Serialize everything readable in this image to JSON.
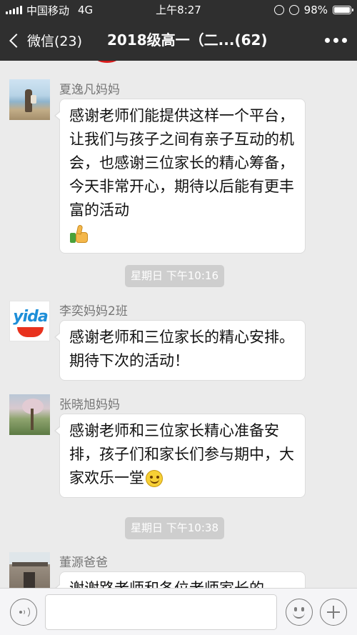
{
  "status_bar": {
    "carrier": "中国移动",
    "network": "4G",
    "time": "上午8:27",
    "battery_text": "98%",
    "battery_level": 0.98
  },
  "nav": {
    "back_label": "微信(23)",
    "title": "2018级高一（二...(62)"
  },
  "messages": [
    {
      "sender": "夏逸凡妈妈",
      "avatar": "beach-photo-avatar",
      "text": "感谢老师们能提供这样一个平台，让我们与孩子之间有亲子互动的机会，也感谢三位家长的精心筹备，今天非常开心，期待以后能有更丰富的活动",
      "emoji": "thumbs-up-emoji"
    },
    {
      "sender": "李奕妈妈2班",
      "avatar": "yida-logo-avatar",
      "avatar_text": "yida",
      "text": "感谢老师和三位家长的精心安排。期待下次的活动！"
    },
    {
      "sender": "张晓旭妈妈",
      "avatar": "blossom-tree-avatar",
      "text": "感谢老师和三位家长精心准备安排，孩子们和家长们参与期中，大家欢乐一堂",
      "emoji": "smile-emoji"
    },
    {
      "sender": "董源爸爸",
      "avatar": "building-photo-avatar",
      "text": "谢谢路老师和各位老师家长的"
    }
  ],
  "time_separators": [
    "星期日 下午10:16",
    "星期日 下午10:38"
  ],
  "input_bar": {
    "icons": [
      "voice-icon",
      "emoji-icon",
      "plus-icon"
    ]
  },
  "colors": {
    "header_bg": "#2f2f2f",
    "chat_bg": "#ebebeb",
    "bubble_bg": "#ffffff",
    "time_sep_bg": "#cecece"
  }
}
